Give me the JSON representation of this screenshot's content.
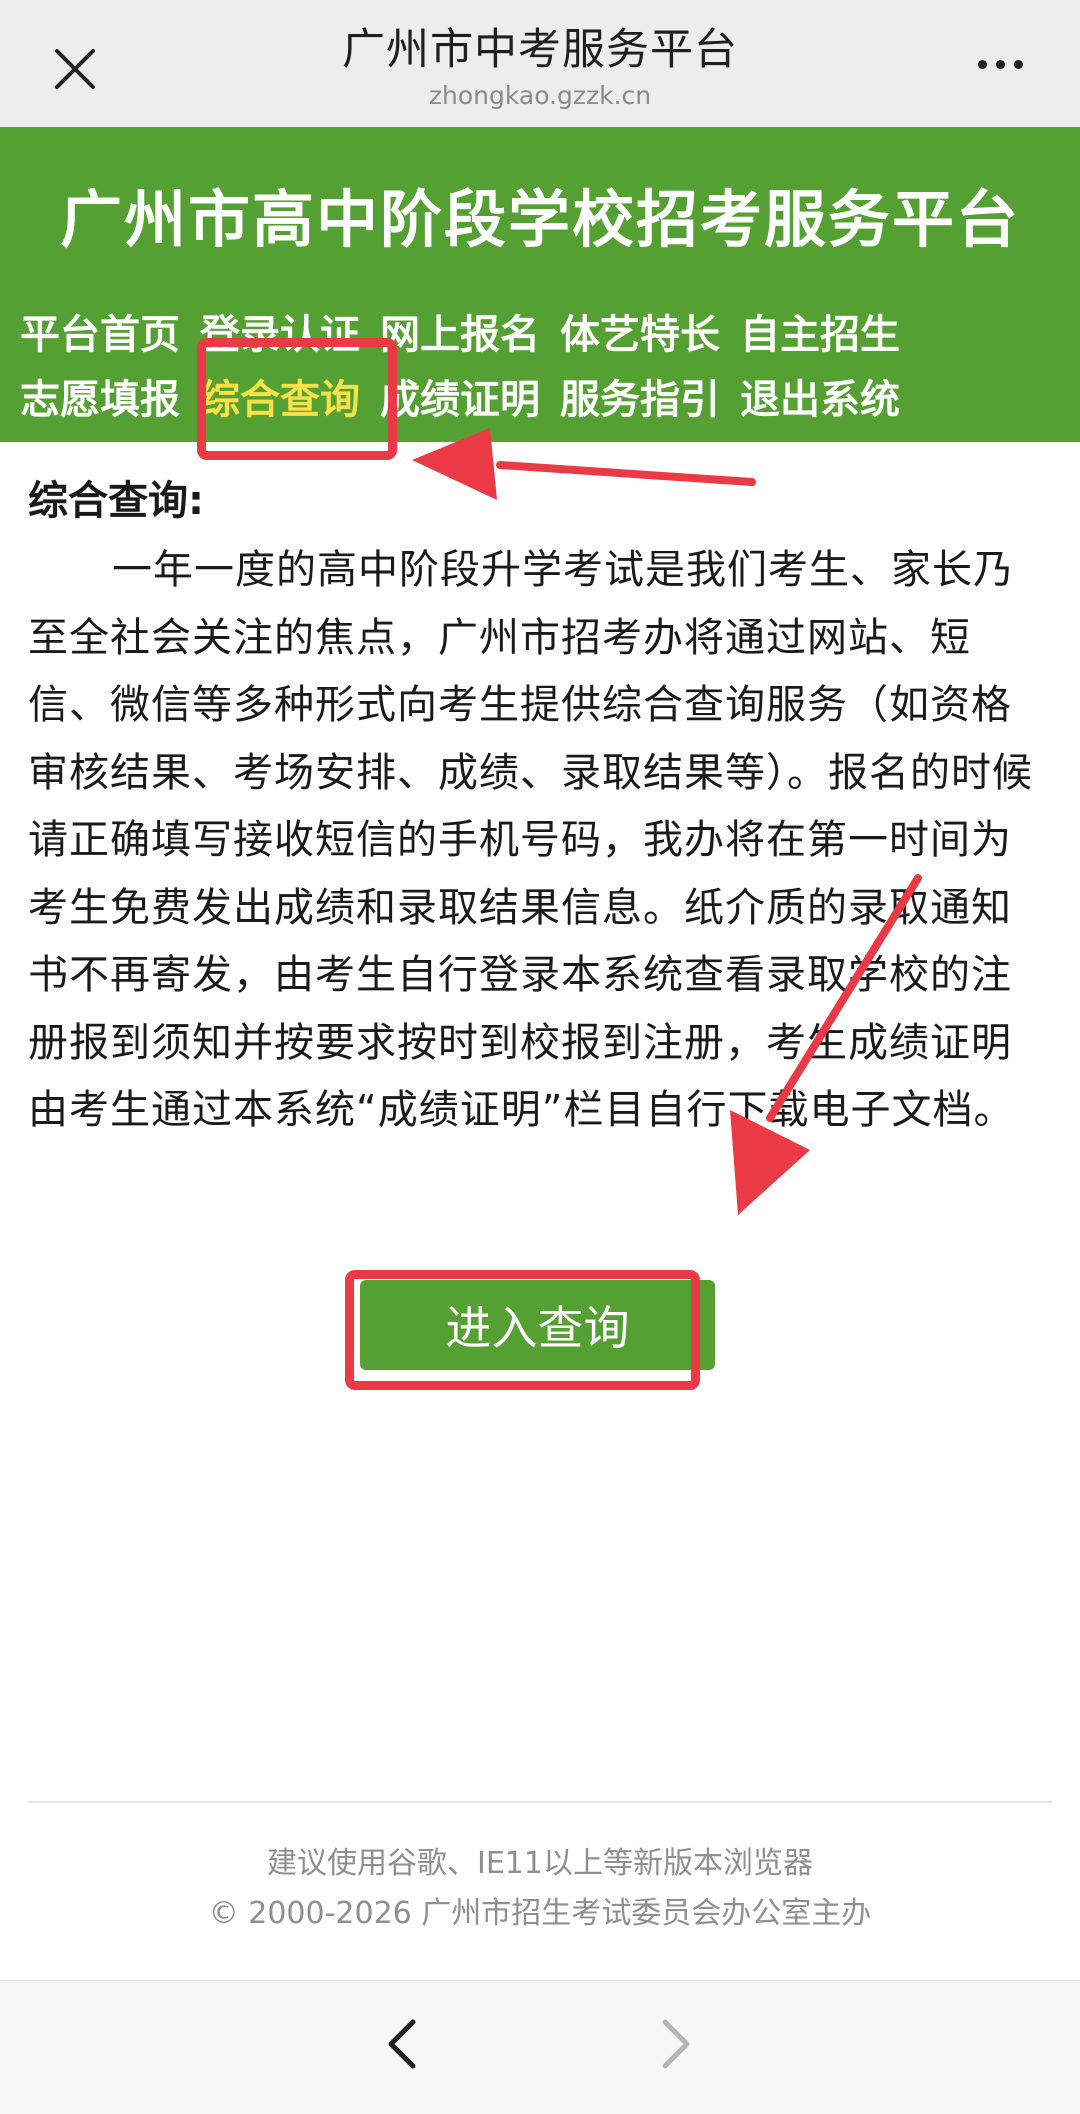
{
  "browser": {
    "title": "广州市中考服务平台",
    "url": "zhongkao.gzzk.cn",
    "close_icon": "close-icon",
    "more_icon": "more-dots-icon"
  },
  "site": {
    "title": "广州市高中阶段学校招考服务平台",
    "nav_row1": [
      "平台首页",
      "登录认证",
      "网上报名",
      "体艺特长",
      "自主招生"
    ],
    "nav_row2": [
      "志愿填报",
      "综合查询",
      "成绩证明",
      "服务指引",
      "退出系统"
    ],
    "active_nav": "综合查询"
  },
  "content": {
    "heading": "综合查询:",
    "paragraph": "一年一度的高中阶段升学考试是我们考生、家长乃至全社会关注的焦点，广州市招考办将通过网站、短信、微信等多种形式向考生提供综合查询服务（如资格审核结果、考场安排、成绩、录取结果等）。报名的时候请正确填写接收短信的手机号码，我办将在第一时间为考生免费发出成绩和录取结果信息。纸介质的录取通知书不再寄发，由考生自行登录本系统查看录取学校的注册报到须知并按要求按时到校报到注册，考生成绩证明由考生通过本系统“成绩证明”栏目自行下载电子文档。",
    "enter_button": "进入查询"
  },
  "footer": {
    "line1": "建议使用谷歌、IE11以上等新版本浏览器",
    "line2": "© 2000-2026 广州市招生考试委员会办公室主办"
  },
  "colors": {
    "header_green": "#55a032",
    "active_nav": "#f5e14a",
    "annotation_red": "#ea3a45"
  }
}
